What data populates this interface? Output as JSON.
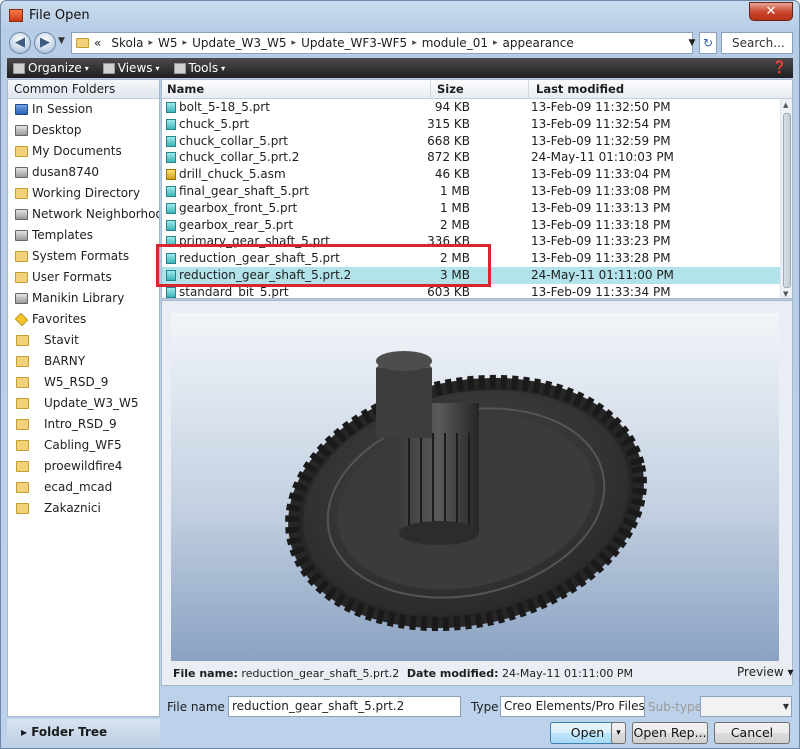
{
  "window": {
    "title": "File Open",
    "close_label": "✕"
  },
  "nav": {
    "back": "◀",
    "forward": "▶",
    "dropdown": "▼"
  },
  "address": {
    "lead": "«",
    "crumbs": [
      "Skola",
      "W5",
      "Update_W3_W5",
      "Update_WF3-WF5",
      "module_01",
      "appearance"
    ],
    "separator": "▸",
    "dropdown": "▼",
    "refresh": "↻",
    "search_placeholder": "Search..."
  },
  "toolbar": {
    "organize": "Organize",
    "views": "Views",
    "tools": "Tools",
    "caret": "▾",
    "help": "❓"
  },
  "sidebar": {
    "header": "Common Folders",
    "items": [
      {
        "label": "In Session",
        "icon": "session-icon"
      },
      {
        "label": "Desktop",
        "icon": "desktop-icon"
      },
      {
        "label": "My Documents",
        "icon": "documents-icon"
      },
      {
        "label": "dusan8740",
        "icon": "computer-icon"
      },
      {
        "label": "Working Directory",
        "icon": "working-directory-icon"
      },
      {
        "label": "Network Neighborhood",
        "icon": "network-icon"
      },
      {
        "label": "Templates",
        "icon": "templates-icon"
      },
      {
        "label": "System Formats",
        "icon": "system-formats-icon"
      },
      {
        "label": "User Formats",
        "icon": "user-formats-icon"
      },
      {
        "label": "Manikin Library",
        "icon": "manikin-icon"
      },
      {
        "label": "Favorites",
        "icon": "favorites-icon"
      }
    ],
    "favorites": [
      "Stavit",
      "BARNY",
      "W5_RSD_9",
      "Update_W3_W5",
      "Intro_RSD_9",
      "Cabling_WF5",
      "proewildfire4",
      "ecad_mcad",
      "Zakaznici"
    ],
    "folder_tree": "Folder Tree",
    "folder_tree_arrow": "▸"
  },
  "filelist": {
    "columns": {
      "name": "Name",
      "size": "Size",
      "modified": "Last modified"
    },
    "rows": [
      {
        "name": "bolt_5-18_5.prt",
        "size": "94 KB",
        "modified": "13-Feb-09 11:32:50 PM",
        "type": "part"
      },
      {
        "name": "chuck_5.prt",
        "size": "315 KB",
        "modified": "13-Feb-09 11:32:54 PM",
        "type": "part"
      },
      {
        "name": "chuck_collar_5.prt",
        "size": "668 KB",
        "modified": "13-Feb-09 11:32:59 PM",
        "type": "part"
      },
      {
        "name": "chuck_collar_5.prt.2",
        "size": "872 KB",
        "modified": "24-May-11 01:10:03 PM",
        "type": "part"
      },
      {
        "name": "drill_chuck_5.asm",
        "size": "46 KB",
        "modified": "13-Feb-09 11:33:04 PM",
        "type": "assembly"
      },
      {
        "name": "final_gear_shaft_5.prt",
        "size": "1 MB",
        "modified": "13-Feb-09 11:33:08 PM",
        "type": "part"
      },
      {
        "name": "gearbox_front_5.prt",
        "size": "1 MB",
        "modified": "13-Feb-09 11:33:13 PM",
        "type": "part"
      },
      {
        "name": "gearbox_rear_5.prt",
        "size": "2 MB",
        "modified": "13-Feb-09 11:33:18 PM",
        "type": "part"
      },
      {
        "name": "primary_gear_shaft_5.prt",
        "size": "336 KB",
        "modified": "13-Feb-09 11:33:23 PM",
        "type": "part"
      },
      {
        "name": "reduction_gear_shaft_5.prt",
        "size": "2 MB",
        "modified": "13-Feb-09 11:33:28 PM",
        "type": "part"
      },
      {
        "name": "reduction_gear_shaft_5.prt.2",
        "size": "3 MB",
        "modified": "24-May-11 01:11:00 PM",
        "type": "part",
        "selected": true
      },
      {
        "name": "standard_bit_5.prt",
        "size": "603 KB",
        "modified": "13-Feb-09 11:33:34 PM",
        "type": "part"
      }
    ]
  },
  "details": {
    "name_label": "File name:",
    "name_value": "reduction_gear_shaft_5.prt.2",
    "date_label": "Date modified:",
    "date_value": "24-May-11 01:11:00 PM",
    "preview_label": "Preview ▾"
  },
  "bottom": {
    "file_name_label": "File name",
    "file_name_value": "reduction_gear_shaft_5.prt.2",
    "type_label": "Type",
    "type_value": "Creo Elements/Pro Files",
    "subtype_label": "Sub-type",
    "subtype_value": "",
    "open": "Open",
    "open_arrow": "▾",
    "open_rep": "Open Rep...",
    "cancel": "Cancel"
  },
  "colors": {
    "selection": "#b3e3ea",
    "highlight_box": "#d8262e",
    "toolbar": "#2a2a2a"
  }
}
